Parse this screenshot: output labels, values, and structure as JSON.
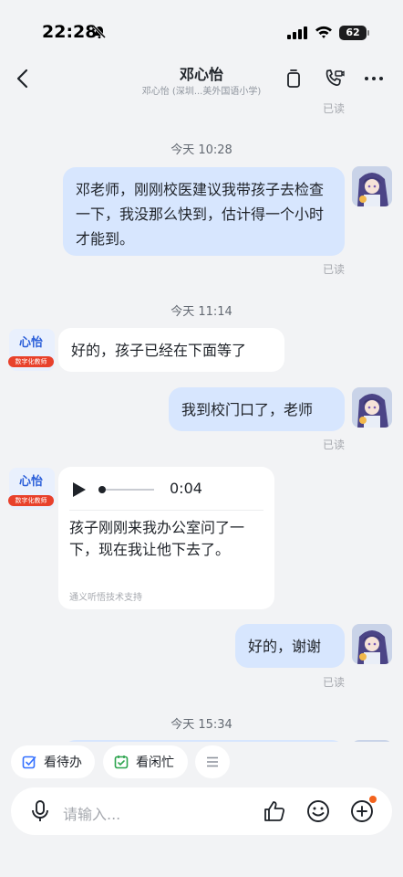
{
  "status_bar": {
    "time": "22:28",
    "battery": "62"
  },
  "header": {
    "title": "邓心怡",
    "subtitle": "邓心怡 (深圳...美外国语小学)"
  },
  "messages": {
    "read_top": "已读",
    "stamp1": "今天 10:28",
    "msg1": "邓老师，刚刚校医建议我带孩子去检查一下，我没那么快到，估计得一个小时才能到。",
    "read1": "已读",
    "stamp2": "今天 11:14",
    "bot_name": "心怡",
    "bot_tag": "数字化教师",
    "msg2": "好的，孩子已经在下面等了",
    "msg3": "我到校门口了，老师",
    "read3": "已读",
    "voice_duration": "0:04",
    "voice_transcript": "孩子刚刚来我办公室问了一下，现在我让他下去了。",
    "voice_credit": "通义听悟技术支持",
    "msg4": "好的，谢谢",
    "read4": "已读",
    "stamp3": "今天 15:34"
  },
  "quick_actions": {
    "todo": "看待办",
    "busy": "看闲忙"
  },
  "input": {
    "placeholder": "请输入..."
  },
  "colors": {
    "my_bubble": "#D7E6FE",
    "their_bubble": "#FFFFFF",
    "accent": "#2B5FD9",
    "notify_dot": "#F3631D"
  }
}
